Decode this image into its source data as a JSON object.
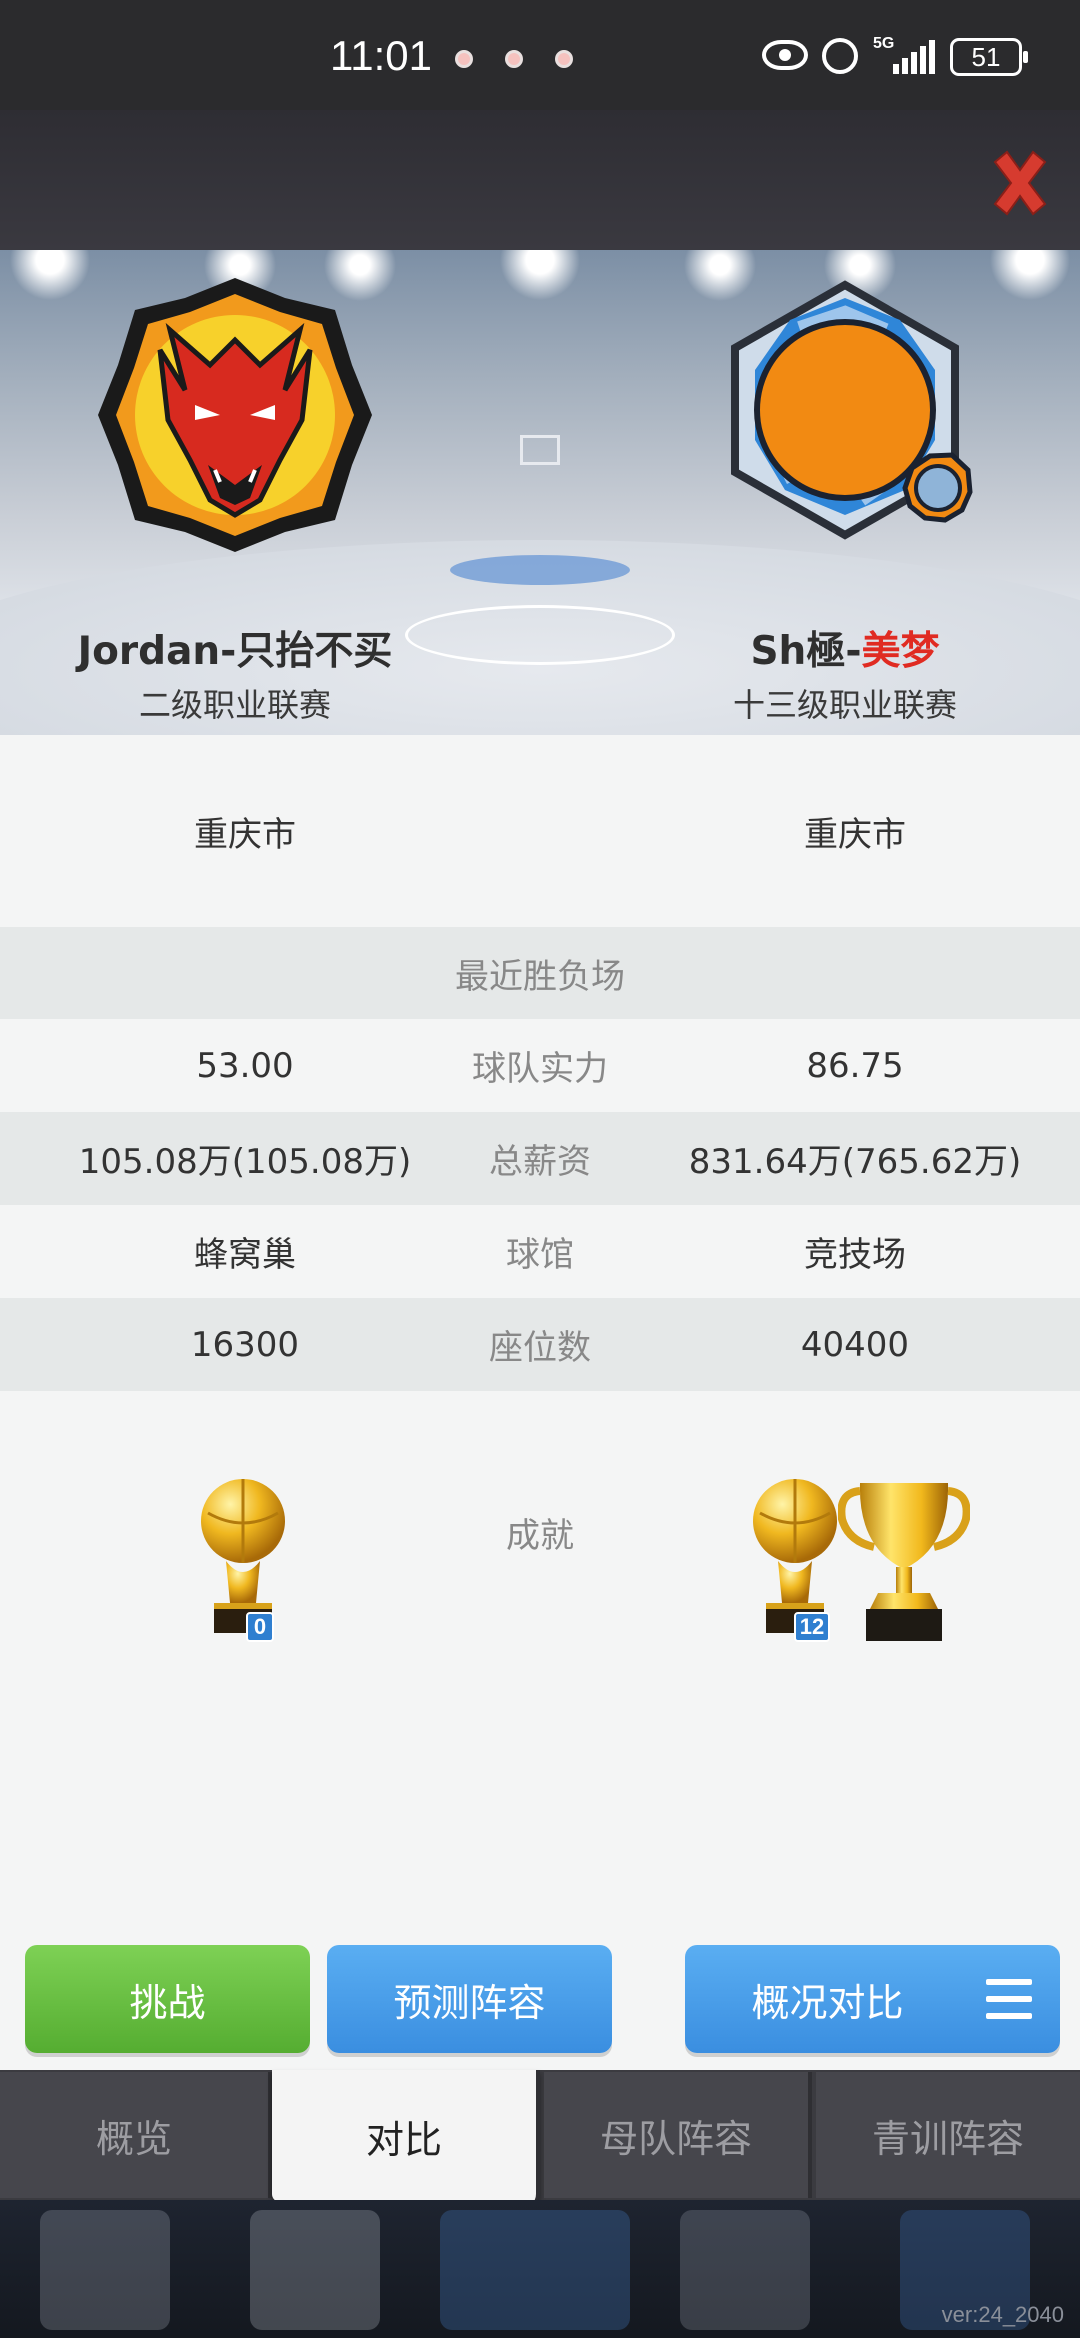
{
  "status_bar": {
    "time": "11:01",
    "network": "5G",
    "battery": "51"
  },
  "teams": {
    "left": {
      "name": "Jordan-只抬不买",
      "league": "二级职业联赛",
      "city": "重庆市"
    },
    "right": {
      "name_prefix": "Sh極-",
      "name_highlight": "美梦",
      "league": "十三级职业联赛",
      "city": "重庆市"
    }
  },
  "rows": {
    "recent": {
      "label": "最近胜负场"
    },
    "strength": {
      "label": "球队实力",
      "left": "53.00",
      "right": "86.75"
    },
    "salary": {
      "label": "总薪资",
      "left": "105.08万(105.08万)",
      "right": "831.64万(765.62万)"
    },
    "arena": {
      "label": "球馆",
      "left": "蜂窝巢",
      "right": "竞技场"
    },
    "seats": {
      "label": "座位数",
      "left": "16300",
      "right": "40400"
    },
    "achievements": {
      "label": "成就",
      "left_count": "0",
      "right_count": "12"
    }
  },
  "buttons": {
    "challenge": "挑战",
    "predict": "预测阵容",
    "compare": "概况对比"
  },
  "tabs": [
    "概览",
    "对比",
    "母队阵容",
    "青训阵容"
  ],
  "active_tab": "对比",
  "version": "ver:24_2040",
  "colors": {
    "highlight_red": "#e02b22",
    "button_green": "#62bb3d",
    "button_blue": "#4a9be8"
  }
}
